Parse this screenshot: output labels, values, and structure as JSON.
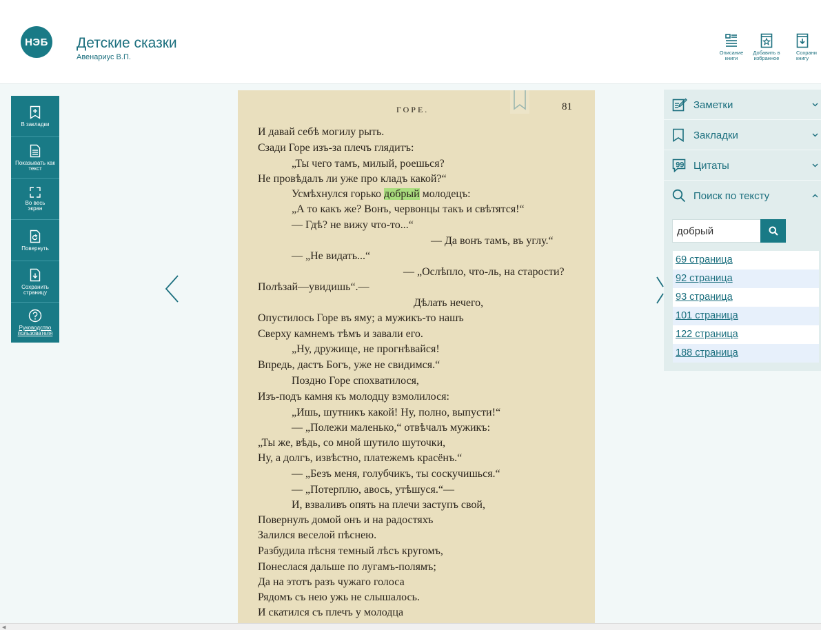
{
  "header": {
    "logo": "НЭБ",
    "title": "Детские сказки",
    "author": "Авенариус В.П.",
    "tools": [
      {
        "label": "Описание книги",
        "icon": "description-icon"
      },
      {
        "label": "Добавить в избранное",
        "icon": "favorite-add-icon"
      },
      {
        "label": "Сохрани книгу",
        "icon": "save-book-icon"
      }
    ]
  },
  "left_toolbar": {
    "bookmarks": "В закладки",
    "as_text": "Показывать как текст",
    "fullscreen": "Во весь экран",
    "rotate": "Повернуть",
    "save_page": "Сохранить страницу",
    "guide": "Руководство пользователя"
  },
  "page": {
    "header": "ГОРЕ.",
    "number": "81",
    "lines": [
      "И давай себѣ могилу рыть.",
      "Сзади Горе изъ-за плечъ глядитъ:",
      "„Ты чего тамъ, милый, роешься?",
      "Не провѣдалъ ли уже про кладъ какой?“",
      "Усмѣхнулся горько ",
      "„А то какъ же? Вонъ, червонцы такъ и свѣтятся!“",
      "— Гдѣ? не вижу что-то...“",
      "— Да вонъ тамъ, въ углу.“",
      "— „Не видать...“",
      "— „Ослѣпло, что-ль, на старости?",
      "Полѣзай—увидишь“.—",
      "Дѣлать нечего,",
      "Опустилось Горе въ яму; а мужикъ-то нашъ",
      "Сверху камнемъ тѣмъ и завали его.",
      "„Ну, дружище, не прогнѣвайся!",
      "Впредь, дастъ Богъ, уже не свидимся.“",
      "Поздно Горе спохватилося,",
      "Изъ-подъ камня къ молодцу взмолилося:",
      "„Ишь, шутникъ какой! Ну, полно, выпусти!“",
      "— „Полежи маленько,“ отвѣчалъ мужикъ:",
      "„Ты же, вѣдь, со мной шутило шуточки,",
      "Ну, а долгъ, извѣстно, платежемъ красёнъ.“",
      "— „Безъ меня, голубчикъ, ты соскучишься.“",
      "— „Потерплю, авось, утѣшуся.“—",
      "И, взваливъ опять на плечи заступъ свой,",
      "Повернулъ домой онъ и на радостяхъ",
      "Залился веселой пѣснею.",
      "Разбудила пѣсня темный лѣсъ кругомъ,",
      "Понеслася дальше по лугамъ-полямъ;",
      "Да на этотъ разъ чужаго голоса",
      "Рядомъ съ нею ужь не слышалось.",
      "И скатился съ плечъ у молодца"
    ],
    "highlight": "добрый",
    "after_highlight": " молодецъ:"
  },
  "right_panel": {
    "notes": "Заметки",
    "bookmarks": "Закладки",
    "quotes": "Цитаты",
    "search": "Поиск по тексту",
    "search_value": "добрый",
    "results": [
      "69 страница",
      "92 страница",
      "93 страница",
      "101 страница",
      "122 страница",
      "188 страница"
    ]
  },
  "colors": {
    "accent": "#197a86",
    "highlight": "#a9dd7e",
    "page": "#e9dfbe"
  }
}
